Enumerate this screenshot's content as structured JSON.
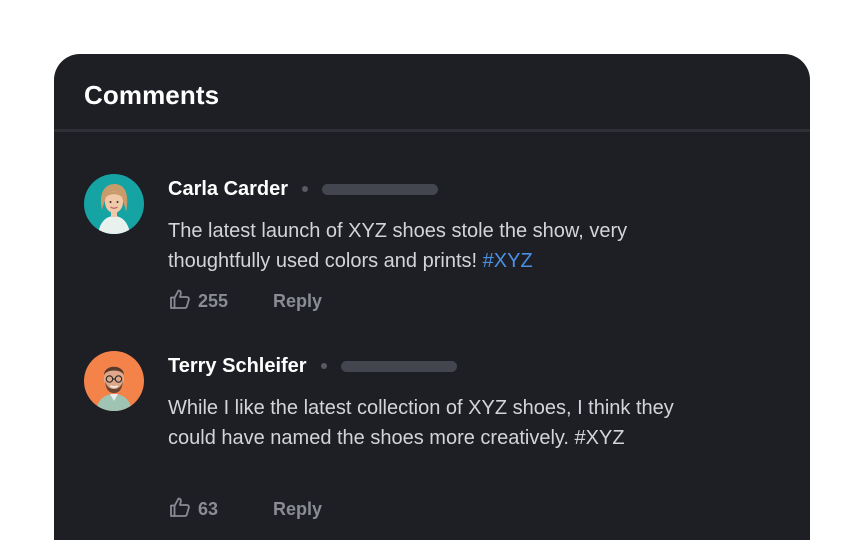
{
  "header": {
    "title": "Comments"
  },
  "comments": [
    {
      "author": "Carla Carder",
      "text": "The latest launch of XYZ shoes stole the show, very thoughtfully used colors and prints!",
      "hashtag": "#XYZ",
      "likes": "255",
      "reply_label": "Reply",
      "avatar_bg": "#16a3a3"
    },
    {
      "author": "Terry Schleifer",
      "text": "While I like the latest collection of XYZ shoes, I think they could have named the shoes more creatively.",
      "hashtag": "#XYZ",
      "likes": "63",
      "reply_label": "Reply",
      "avatar_bg": "#f4834a"
    }
  ],
  "icons": {
    "like": "thumbs-up-icon",
    "separator": "dot-separator"
  },
  "colors": {
    "panel": "#1e1f25",
    "hashtag": "#4a90e2",
    "muted": "#8a8c95"
  }
}
